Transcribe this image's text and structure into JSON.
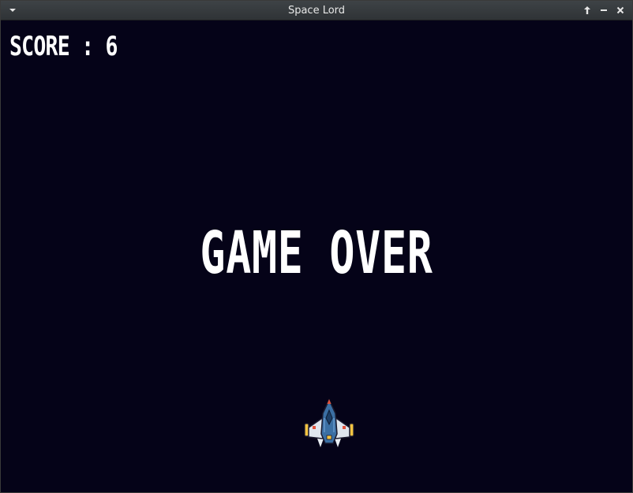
{
  "window": {
    "title": "Space Lord",
    "icons": {
      "menu": "chevron-down-icon",
      "maximize": "arrow-up-icon",
      "minimize": "minus-icon",
      "close": "close-icon"
    }
  },
  "game": {
    "score_text": "SCORE : 6",
    "game_over_text": "GAME OVER",
    "colors": {
      "background": "#050318",
      "text": "#ffffff",
      "ship_body": "#3b6fa3",
      "ship_wing": "#dfe6ee",
      "ship_accent": "#f5c542",
      "ship_tip": "#e0533d"
    }
  }
}
